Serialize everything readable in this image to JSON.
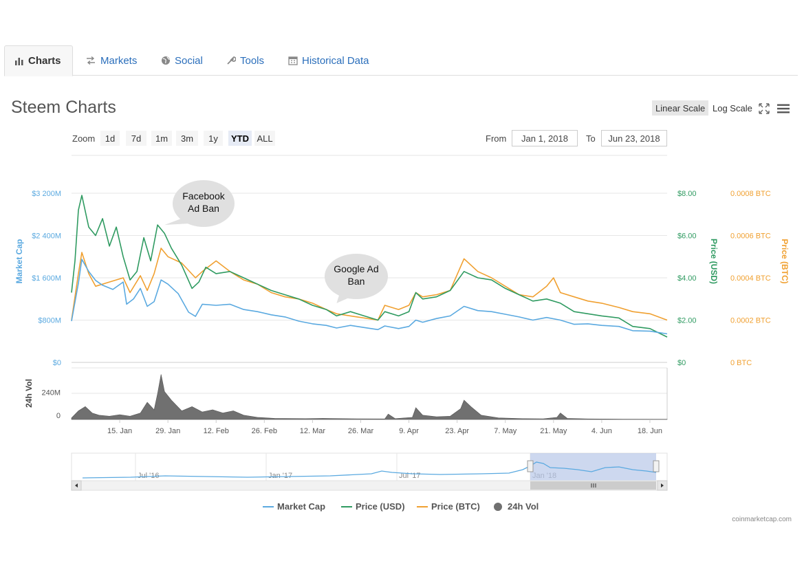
{
  "tabs": [
    {
      "label": "Charts",
      "icon": "bar-chart-icon",
      "active": true
    },
    {
      "label": "Markets",
      "icon": "exchange-icon",
      "active": false
    },
    {
      "label": "Social",
      "icon": "globe-icon",
      "active": false
    },
    {
      "label": "Tools",
      "icon": "wrench-icon",
      "active": false
    },
    {
      "label": "Historical Data",
      "icon": "calendar-icon",
      "active": false
    }
  ],
  "page_title": "Steem Charts",
  "scale": {
    "linear_label": "Linear Scale",
    "log_label": "Log Scale",
    "active": "linear"
  },
  "zoom": {
    "label": "Zoom",
    "options": [
      "1d",
      "7d",
      "1m",
      "3m",
      "1y",
      "YTD",
      "ALL"
    ],
    "active": "YTD"
  },
  "range": {
    "from_label": "From",
    "from_value": "Jan 1, 2018",
    "to_label": "To",
    "to_value": "Jun 23, 2018"
  },
  "colors": {
    "market_cap": "#5aa9e0",
    "price_usd": "#2e9a60",
    "price_btc": "#f0a030",
    "volume": "#707070",
    "navigator_mask": "#b8c8e8"
  },
  "chart_data": {
    "type": "line",
    "x_range": [
      "2018-01-01",
      "2018-06-23"
    ],
    "x_tick_labels": [
      "15. Jan",
      "29. Jan",
      "12. Feb",
      "26. Feb",
      "12. Mar",
      "26. Mar",
      "9. Apr",
      "23. Apr",
      "7. May",
      "21. May",
      "4. Jun",
      "18. Jun"
    ],
    "axes": {
      "market_cap": {
        "title": "Market Cap",
        "ticks": [
          "$0",
          "$800M",
          "$1 600M",
          "$2 400M",
          "$3 200M"
        ],
        "range": [
          0,
          3200000000
        ]
      },
      "price_usd": {
        "title": "Price (USD)",
        "ticks": [
          "$0",
          "$2.00",
          "$4.00",
          "$6.00",
          "$8.00"
        ],
        "range": [
          0,
          8
        ]
      },
      "price_btc": {
        "title": "Price (BTC)",
        "ticks": [
          "0 BTC",
          "0.0002 BTC",
          "0.0004 BTC",
          "0.0006 BTC",
          "0.0008 BTC"
        ],
        "range": [
          0,
          0.0008
        ]
      },
      "volume": {
        "title": "24h Vol",
        "ticks": [
          "0",
          "240M"
        ],
        "range": [
          0,
          480000000
        ]
      }
    },
    "series": [
      {
        "name": "Market Cap",
        "axis": "market_cap",
        "points": [
          [
            "2018-01-01",
            780000000
          ],
          [
            "2018-01-03",
            1500000000
          ],
          [
            "2018-01-04",
            1950000000
          ],
          [
            "2018-01-06",
            1720000000
          ],
          [
            "2018-01-08",
            1550000000
          ],
          [
            "2018-01-10",
            1460000000
          ],
          [
            "2018-01-13",
            1380000000
          ],
          [
            "2018-01-16",
            1520000000
          ],
          [
            "2018-01-17",
            1100000000
          ],
          [
            "2018-01-19",
            1200000000
          ],
          [
            "2018-01-21",
            1400000000
          ],
          [
            "2018-01-23",
            1060000000
          ],
          [
            "2018-01-25",
            1150000000
          ],
          [
            "2018-01-27",
            1560000000
          ],
          [
            "2018-01-29",
            1480000000
          ],
          [
            "2018-02-01",
            1300000000
          ],
          [
            "2018-02-04",
            950000000
          ],
          [
            "2018-02-06",
            870000000
          ],
          [
            "2018-02-08",
            1100000000
          ],
          [
            "2018-02-12",
            1080000000
          ],
          [
            "2018-02-16",
            1100000000
          ],
          [
            "2018-02-20",
            1000000000
          ],
          [
            "2018-02-24",
            960000000
          ],
          [
            "2018-02-28",
            900000000
          ],
          [
            "2018-03-04",
            860000000
          ],
          [
            "2018-03-08",
            780000000
          ],
          [
            "2018-03-12",
            730000000
          ],
          [
            "2018-03-16",
            700000000
          ],
          [
            "2018-03-19",
            650000000
          ],
          [
            "2018-03-23",
            700000000
          ],
          [
            "2018-03-27",
            660000000
          ],
          [
            "2018-03-31",
            620000000
          ],
          [
            "2018-04-02",
            690000000
          ],
          [
            "2018-04-06",
            640000000
          ],
          [
            "2018-04-09",
            680000000
          ],
          [
            "2018-04-11",
            800000000
          ],
          [
            "2018-04-13",
            760000000
          ],
          [
            "2018-04-17",
            830000000
          ],
          [
            "2018-04-21",
            880000000
          ],
          [
            "2018-04-25",
            1060000000
          ],
          [
            "2018-04-29",
            980000000
          ],
          [
            "2018-05-03",
            960000000
          ],
          [
            "2018-05-07",
            910000000
          ],
          [
            "2018-05-11",
            860000000
          ],
          [
            "2018-05-15",
            800000000
          ],
          [
            "2018-05-19",
            850000000
          ],
          [
            "2018-05-23",
            800000000
          ],
          [
            "2018-05-27",
            720000000
          ],
          [
            "2018-05-31",
            730000000
          ],
          [
            "2018-06-04",
            700000000
          ],
          [
            "2018-06-09",
            680000000
          ],
          [
            "2018-06-13",
            600000000
          ],
          [
            "2018-06-18",
            590000000
          ],
          [
            "2018-06-23",
            540000000
          ]
        ]
      },
      {
        "name": "Price (USD)",
        "axis": "price_usd",
        "points": [
          [
            "2018-01-01",
            3.3
          ],
          [
            "2018-01-02",
            4.8
          ],
          [
            "2018-01-03",
            7.2
          ],
          [
            "2018-01-04",
            7.9
          ],
          [
            "2018-01-06",
            6.4
          ],
          [
            "2018-01-08",
            6.0
          ],
          [
            "2018-01-10",
            6.8
          ],
          [
            "2018-01-12",
            5.5
          ],
          [
            "2018-01-14",
            6.4
          ],
          [
            "2018-01-16",
            5.0
          ],
          [
            "2018-01-18",
            3.9
          ],
          [
            "2018-01-20",
            4.3
          ],
          [
            "2018-01-22",
            5.9
          ],
          [
            "2018-01-24",
            4.8
          ],
          [
            "2018-01-26",
            6.5
          ],
          [
            "2018-01-28",
            6.1
          ],
          [
            "2018-01-30",
            5.4
          ],
          [
            "2018-02-02",
            4.6
          ],
          [
            "2018-02-05",
            3.5
          ],
          [
            "2018-02-07",
            3.8
          ],
          [
            "2018-02-09",
            4.5
          ],
          [
            "2018-02-12",
            4.2
          ],
          [
            "2018-02-16",
            4.3
          ],
          [
            "2018-02-20",
            4.0
          ],
          [
            "2018-02-24",
            3.7
          ],
          [
            "2018-02-28",
            3.4
          ],
          [
            "2018-03-04",
            3.2
          ],
          [
            "2018-03-08",
            3.0
          ],
          [
            "2018-03-12",
            2.7
          ],
          [
            "2018-03-16",
            2.5
          ],
          [
            "2018-03-19",
            2.2
          ],
          [
            "2018-03-23",
            2.4
          ],
          [
            "2018-03-27",
            2.2
          ],
          [
            "2018-03-31",
            2.0
          ],
          [
            "2018-04-02",
            2.4
          ],
          [
            "2018-04-06",
            2.2
          ],
          [
            "2018-04-09",
            2.4
          ],
          [
            "2018-04-11",
            3.3
          ],
          [
            "2018-04-13",
            3.0
          ],
          [
            "2018-04-17",
            3.1
          ],
          [
            "2018-04-21",
            3.4
          ],
          [
            "2018-04-25",
            4.3
          ],
          [
            "2018-04-29",
            4.0
          ],
          [
            "2018-05-03",
            3.9
          ],
          [
            "2018-05-07",
            3.5
          ],
          [
            "2018-05-11",
            3.2
          ],
          [
            "2018-05-15",
            2.9
          ],
          [
            "2018-05-19",
            3.0
          ],
          [
            "2018-05-23",
            2.8
          ],
          [
            "2018-05-27",
            2.4
          ],
          [
            "2018-05-31",
            2.3
          ],
          [
            "2018-06-04",
            2.2
          ],
          [
            "2018-06-09",
            2.1
          ],
          [
            "2018-06-13",
            1.7
          ],
          [
            "2018-06-18",
            1.6
          ],
          [
            "2018-06-23",
            1.2
          ]
        ]
      },
      {
        "name": "Price (BTC)",
        "axis": "price_btc",
        "points": [
          [
            "2018-01-01",
            0.0002
          ],
          [
            "2018-01-03",
            0.00042
          ],
          [
            "2018-01-04",
            0.00052
          ],
          [
            "2018-01-06",
            0.00042
          ],
          [
            "2018-01-08",
            0.00036
          ],
          [
            "2018-01-12",
            0.00038
          ],
          [
            "2018-01-16",
            0.0004
          ],
          [
            "2018-01-18",
            0.00033
          ],
          [
            "2018-01-21",
            0.00041
          ],
          [
            "2018-01-23",
            0.00034
          ],
          [
            "2018-01-25",
            0.00042
          ],
          [
            "2018-01-27",
            0.00054
          ],
          [
            "2018-01-29",
            0.0005
          ],
          [
            "2018-02-02",
            0.00047
          ],
          [
            "2018-02-06",
            0.0004
          ],
          [
            "2018-02-08",
            0.00043
          ],
          [
            "2018-02-12",
            0.00048
          ],
          [
            "2018-02-16",
            0.00043
          ],
          [
            "2018-02-20",
            0.00039
          ],
          [
            "2018-02-24",
            0.00037
          ],
          [
            "2018-02-28",
            0.00033
          ],
          [
            "2018-03-04",
            0.00031
          ],
          [
            "2018-03-08",
            0.0003
          ],
          [
            "2018-03-12",
            0.00028
          ],
          [
            "2018-03-16",
            0.00025
          ],
          [
            "2018-03-19",
            0.00023
          ],
          [
            "2018-03-23",
            0.00022
          ],
          [
            "2018-03-27",
            0.00021
          ],
          [
            "2018-03-31",
            0.0002
          ],
          [
            "2018-04-02",
            0.00027
          ],
          [
            "2018-04-06",
            0.00025
          ],
          [
            "2018-04-09",
            0.00027
          ],
          [
            "2018-04-11",
            0.00033
          ],
          [
            "2018-04-13",
            0.00031
          ],
          [
            "2018-04-17",
            0.00032
          ],
          [
            "2018-04-21",
            0.00034
          ],
          [
            "2018-04-25",
            0.00049
          ],
          [
            "2018-04-29",
            0.00043
          ],
          [
            "2018-05-03",
            0.0004
          ],
          [
            "2018-05-07",
            0.00036
          ],
          [
            "2018-05-11",
            0.00032
          ],
          [
            "2018-05-15",
            0.00031
          ],
          [
            "2018-05-19",
            0.00036
          ],
          [
            "2018-05-21",
            0.0004
          ],
          [
            "2018-05-23",
            0.00033
          ],
          [
            "2018-05-27",
            0.00031
          ],
          [
            "2018-05-31",
            0.00029
          ],
          [
            "2018-06-04",
            0.00028
          ],
          [
            "2018-06-09",
            0.00026
          ],
          [
            "2018-06-13",
            0.00024
          ],
          [
            "2018-06-18",
            0.00023
          ],
          [
            "2018-06-23",
            0.0002
          ]
        ]
      },
      {
        "name": "24h Vol",
        "axis": "volume",
        "type": "area",
        "points": [
          [
            "2018-01-01",
            15000000
          ],
          [
            "2018-01-03",
            80000000
          ],
          [
            "2018-01-05",
            120000000
          ],
          [
            "2018-01-07",
            60000000
          ],
          [
            "2018-01-09",
            40000000
          ],
          [
            "2018-01-12",
            30000000
          ],
          [
            "2018-01-15",
            45000000
          ],
          [
            "2018-01-18",
            30000000
          ],
          [
            "2018-01-21",
            60000000
          ],
          [
            "2018-01-23",
            160000000
          ],
          [
            "2018-01-25",
            90000000
          ],
          [
            "2018-01-26",
            240000000
          ],
          [
            "2018-01-27",
            420000000
          ],
          [
            "2018-01-28",
            260000000
          ],
          [
            "2018-01-30",
            180000000
          ],
          [
            "2018-02-02",
            80000000
          ],
          [
            "2018-02-05",
            120000000
          ],
          [
            "2018-02-08",
            70000000
          ],
          [
            "2018-02-11",
            90000000
          ],
          [
            "2018-02-14",
            60000000
          ],
          [
            "2018-02-17",
            80000000
          ],
          [
            "2018-02-20",
            40000000
          ],
          [
            "2018-02-24",
            20000000
          ],
          [
            "2018-03-01",
            10000000
          ],
          [
            "2018-03-10",
            8000000
          ],
          [
            "2018-03-15",
            10000000
          ],
          [
            "2018-03-25",
            6000000
          ],
          [
            "2018-04-02",
            5000000
          ],
          [
            "2018-04-03",
            50000000
          ],
          [
            "2018-04-05",
            8000000
          ],
          [
            "2018-04-10",
            20000000
          ],
          [
            "2018-04-11",
            110000000
          ],
          [
            "2018-04-13",
            40000000
          ],
          [
            "2018-04-17",
            25000000
          ],
          [
            "2018-04-21",
            30000000
          ],
          [
            "2018-04-24",
            100000000
          ],
          [
            "2018-04-25",
            180000000
          ],
          [
            "2018-04-27",
            120000000
          ],
          [
            "2018-04-30",
            40000000
          ],
          [
            "2018-05-05",
            15000000
          ],
          [
            "2018-05-12",
            8000000
          ],
          [
            "2018-05-18",
            6000000
          ],
          [
            "2018-05-22",
            20000000
          ],
          [
            "2018-05-23",
            60000000
          ],
          [
            "2018-05-25",
            10000000
          ],
          [
            "2018-05-31",
            5000000
          ],
          [
            "2018-06-10",
            3000000
          ],
          [
            "2018-06-23",
            2000000
          ]
        ]
      }
    ],
    "annotations": [
      {
        "text_lines": [
          "Facebook",
          "Ad Ban"
        ],
        "date": "2018-01-28",
        "axis": "price_usd",
        "value": 6.5
      },
      {
        "text_lines": [
          "Google Ad",
          "Ban"
        ],
        "date": "2018-03-19",
        "axis": "price_usd",
        "value": 2.8
      }
    ],
    "navigator": {
      "labels": [
        "Jul '16",
        "Jan '17",
        "Jul '17",
        "Jan '18"
      ],
      "selection": [
        "2018-01-01",
        "2018-06-23"
      ]
    },
    "legend": {
      "position": "bottom",
      "items": [
        "Market Cap",
        "Price (USD)",
        "Price (BTC)",
        "24h Vol"
      ]
    }
  },
  "credit": "coinmarketcap.com"
}
